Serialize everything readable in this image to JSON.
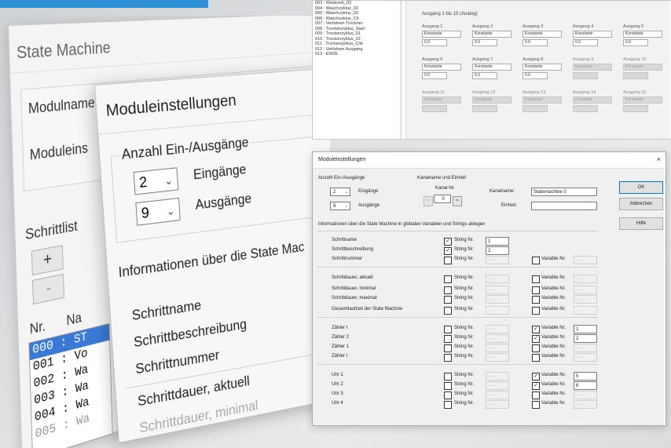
{
  "state_machine": {
    "title": "State Machine",
    "label_modulname": "Modulname",
    "label_moduleinstellungen": "Moduleins",
    "label_schrittliste": "Schrittlist",
    "btn_add": "+",
    "btn_remove": "-",
    "col_nr": "Nr.",
    "col_name": "Na",
    "list": [
      "000 : ST",
      "001 : Vo",
      "002 : Wa",
      "003 : Wa",
      "004 : Wa",
      "005 : Wa"
    ]
  },
  "module_settings_large": {
    "title": "Moduleinstellungen",
    "group_label": "Anzahl Ein-/Ausgänge",
    "inputs_count": "2",
    "outputs_count": "9",
    "inputs_label": "Eingänge",
    "outputs_label": "Ausgänge",
    "info_text": "Informationen über die State Mac",
    "rows": [
      "Schrittname",
      "Schrittbeschreibung",
      "Schrittnummer",
      "Schrittdauer, aktuell",
      "Schrittdauer, minimal"
    ]
  },
  "outputs_panel": {
    "step_list": [
      "003 : Wartezeit_03",
      "004 : Waschzyklus_03",
      "005 : Waschzyklus_03",
      "006 : Waschzyklus_Ch",
      "007 : Verfahren Trockner",
      "008 : Trockenzyklus_Start",
      "009 : Trockenzyklus_01",
      "010 : Trockenzyklus_02",
      "011 : Trockenzyklus_Chk",
      "012 : Verfahren Ausgang",
      "013 : ENDE"
    ],
    "group_label": "Ausgang 1 bis 15 (Analog)",
    "cells": [
      {
        "label": "Ausgang 1",
        "mode": "Konstante",
        "value": "0.0",
        "enabled": true
      },
      {
        "label": "Ausgang 2",
        "mode": "Konstante",
        "value": "0.0",
        "enabled": true
      },
      {
        "label": "Ausgang 3",
        "mode": "Konstante",
        "value": "0.0",
        "enabled": true
      },
      {
        "label": "Ausgang 4",
        "mode": "Konstante",
        "value": "0.0",
        "enabled": true
      },
      {
        "label": "Ausgang 5",
        "mode": "Konstante",
        "value": "0.0",
        "enabled": true
      },
      {
        "label": "Ausgang 6",
        "mode": "Konstante",
        "value": "0.0",
        "enabled": true
      },
      {
        "label": "Ausgang 7",
        "mode": "Konstante",
        "value": "0.0",
        "enabled": true
      },
      {
        "label": "Ausgang 8",
        "mode": "Konstante",
        "value": "0.0",
        "enabled": true
      },
      {
        "label": "Ausgang 9",
        "mode": "Konstante",
        "value": "",
        "enabled": false
      },
      {
        "label": "Ausgang 10",
        "mode": "Konstante",
        "value": "",
        "enabled": false
      },
      {
        "label": "Ausgang 11",
        "mode": "Konstante",
        "value": "",
        "enabled": false
      },
      {
        "label": "Ausgang 12",
        "mode": "Konstante",
        "value": "",
        "enabled": false
      },
      {
        "label": "Ausgang 13",
        "mode": "Konstante",
        "value": "",
        "enabled": false
      },
      {
        "label": "Ausgang 14",
        "mode": "Konstante",
        "value": "",
        "enabled": false
      },
      {
        "label": "Ausgang 15",
        "mode": "Konstante",
        "value": "",
        "enabled": false
      }
    ]
  },
  "dialog": {
    "title": "Moduleinstellungen",
    "close": "×",
    "group_io": "Anzahl Ein-/Ausgänge",
    "group_channel": "Kanalname und Einheit",
    "inputs_count": "2",
    "outputs_count": "9",
    "inputs_label": "Eingänge",
    "outputs_label": "Ausgänge",
    "kanal_nr_label": "Kanal-Nr.",
    "kanal_nr_value": "0",
    "kanalname_label": "Kanalname:",
    "kanalname_value": "Statemachine 0",
    "einheit_label": "Einheit:",
    "einheit_value": "",
    "info_label": "Informationen über die State Machine in globalen Variablen und Strings ablegen",
    "ok": "OK",
    "cancel": "Abbrechen",
    "help": "Hilfe",
    "string_label": "String Nr.",
    "variable_label": "Variable Nr.",
    "dashes": "- - -",
    "rows": [
      {
        "name": "Schrittname",
        "s_checked": true,
        "s_val": "1",
        "has_var": false,
        "v_checked": false,
        "v_val": ""
      },
      {
        "name": "Schrittbeschreibung",
        "s_checked": true,
        "s_val": "2",
        "has_var": false,
        "v_checked": false,
        "v_val": ""
      },
      {
        "name": "Schrittnummer",
        "s_checked": false,
        "s_val": "",
        "has_var": true,
        "v_checked": false,
        "v_val": ""
      },
      {
        "name": "Schrittdauer, aktuell",
        "s_checked": false,
        "s_val": "",
        "has_var": true,
        "v_checked": false,
        "v_val": ""
      },
      {
        "name": "Schrittdauer, minimal",
        "s_checked": false,
        "s_val": "",
        "has_var": true,
        "v_checked": false,
        "v_val": ""
      },
      {
        "name": "Schrittdauer, maximal",
        "s_checked": false,
        "s_val": "",
        "has_var": true,
        "v_checked": false,
        "v_val": ""
      },
      {
        "name": "Gesamtlaufzeit der State Machine",
        "s_checked": false,
        "s_val": "",
        "has_var": true,
        "v_checked": false,
        "v_val": ""
      },
      {
        "name": "Zähler I",
        "s_checked": false,
        "s_val": "",
        "has_var": true,
        "v_checked": true,
        "v_val": "1"
      },
      {
        "name": "Zähler 2",
        "s_checked": false,
        "s_val": "",
        "has_var": true,
        "v_checked": true,
        "v_val": "2"
      },
      {
        "name": "Zähler 1",
        "s_checked": false,
        "s_val": "",
        "has_var": true,
        "v_checked": false,
        "v_val": ""
      },
      {
        "name": "Zähler I",
        "s_checked": false,
        "s_val": "",
        "has_var": true,
        "v_checked": false,
        "v_val": ""
      },
      {
        "name": "Uhr 1",
        "s_checked": false,
        "s_val": "",
        "has_var": true,
        "v_checked": true,
        "v_val": "5"
      },
      {
        "name": "Uhr 2",
        "s_checked": false,
        "s_val": "",
        "has_var": true,
        "v_checked": true,
        "v_val": "6"
      },
      {
        "name": "Uhr 3",
        "s_checked": false,
        "s_val": "",
        "has_var": true,
        "v_checked": false,
        "v_val": ""
      },
      {
        "name": "Uhr 4",
        "s_checked": false,
        "s_val": "",
        "has_var": true,
        "v_checked": false,
        "v_val": ""
      }
    ]
  },
  "colors": {
    "accent": "#2f8fd6",
    "selection": "#3a7ad6"
  }
}
